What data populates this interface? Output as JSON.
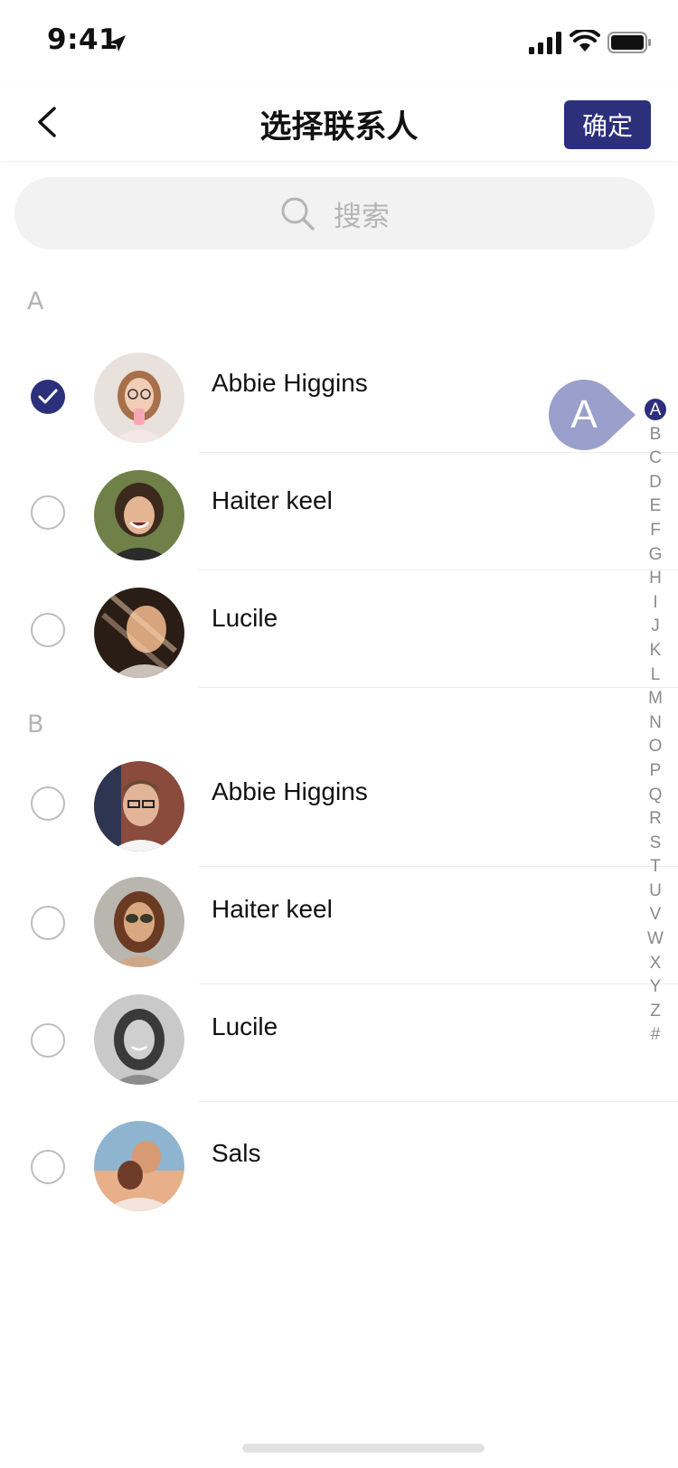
{
  "status_bar": {
    "time": "9:41"
  },
  "nav": {
    "title": "选择联系人",
    "confirm_label": "确定"
  },
  "search": {
    "placeholder": "搜索"
  },
  "sections": [
    {
      "letter": "A",
      "contacts": [
        {
          "name": "Abbie Higgins",
          "checked": true,
          "avatar_color": "#d9b8a6"
        },
        {
          "name": "Haiter keel",
          "checked": false,
          "avatar_color": "#5d6b3f"
        },
        {
          "name": "Lucile",
          "checked": false,
          "avatar_color": "#8a6a52"
        }
      ]
    },
    {
      "letter": "B",
      "contacts": [
        {
          "name": "Abbie Higgins",
          "checked": false,
          "avatar_color": "#7a5a4e"
        },
        {
          "name": "Haiter keel",
          "checked": false,
          "avatar_color": "#a48366"
        },
        {
          "name": "Lucile",
          "checked": false,
          "avatar_color": "#777777"
        },
        {
          "name": "Sals",
          "checked": false,
          "avatar_color": "#c98f6a"
        }
      ]
    }
  ],
  "index_bar": {
    "letters": [
      "A",
      "B",
      "C",
      "D",
      "E",
      "F",
      "G",
      "H",
      "I",
      "J",
      "K",
      "L",
      "M",
      "N",
      "O",
      "P",
      "Q",
      "R",
      "S",
      "T",
      "U",
      "V",
      "W",
      "X",
      "Y",
      "Z",
      "#"
    ],
    "active": "A"
  },
  "colors": {
    "accent": "#2c2f7a",
    "bubble": "#9aa0cb"
  }
}
